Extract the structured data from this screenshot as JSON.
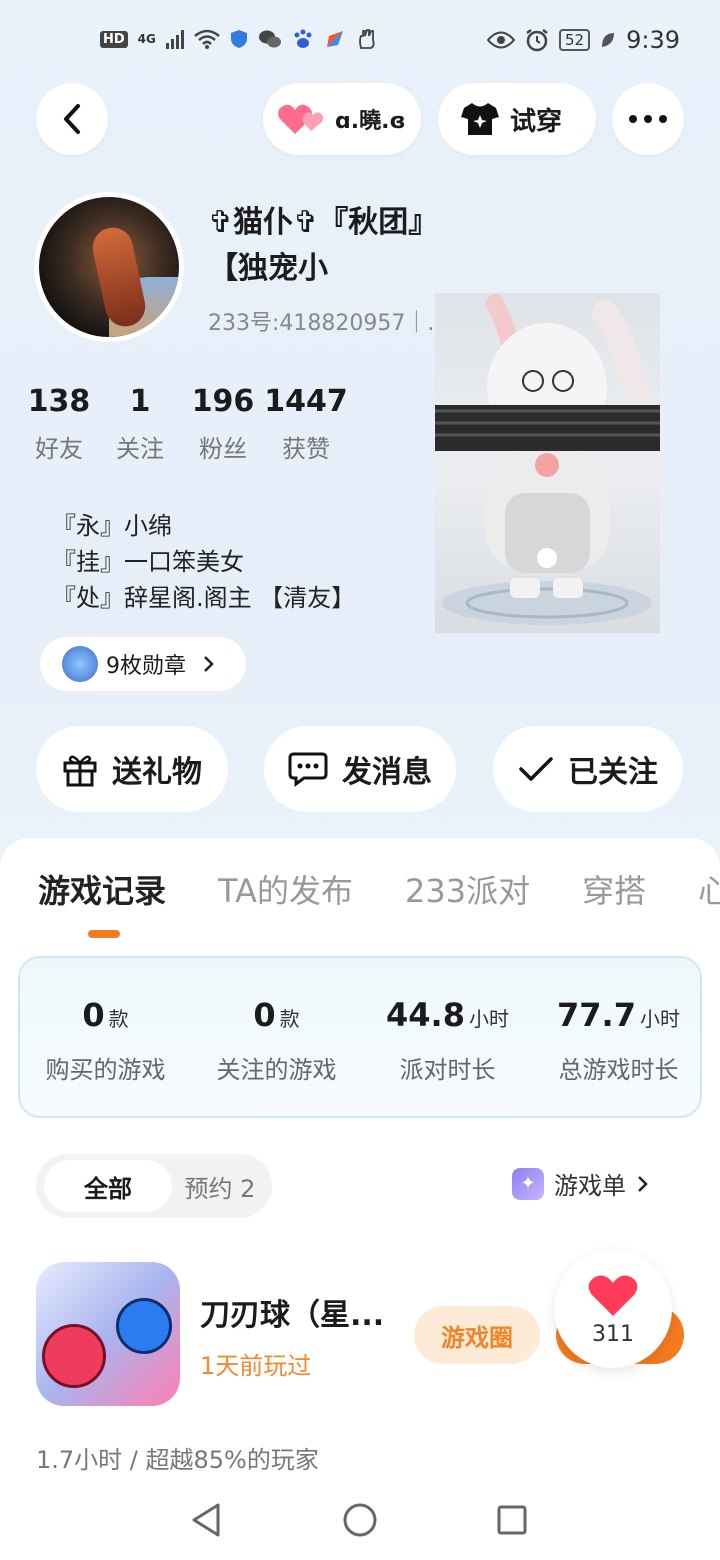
{
  "status_bar": {
    "hd": "HD",
    "network": "4G",
    "time": "9:39",
    "battery": "52"
  },
  "header": {
    "cp_name": "ɑ.曉.ɞ",
    "try_on_label": "试穿"
  },
  "profile": {
    "nickname": "✞猫仆✞『秋团』【独宠小",
    "id_text": "233号:418820957｜..",
    "stats": [
      {
        "num": "138",
        "label": "好友"
      },
      {
        "num": "1",
        "label": "关注"
      },
      {
        "num": "196",
        "label": "粉丝"
      },
      {
        "num": "1447",
        "label": "获赞"
      }
    ],
    "bio": [
      "『永』小绵",
      "『挂』一口笨美女",
      "『处』辞星阁.阁主 【清友】"
    ],
    "badges_label": "9枚勋章"
  },
  "actions": {
    "gift": "送礼物",
    "message": "发消息",
    "followed": "已关注"
  },
  "tabs": [
    "游戏记录",
    "TA的发布",
    "233派对",
    "穿搭",
    "心"
  ],
  "game_stats": [
    {
      "num": "0",
      "unit": "款",
      "label": "购买的游戏"
    },
    {
      "num": "0",
      "unit": "款",
      "label": "关注的游戏"
    },
    {
      "num": "44.8",
      "unit": "小时",
      "label": "派对时长"
    },
    {
      "num": "77.7",
      "unit": "小时",
      "label": "总游戏时长"
    }
  ],
  "segment": {
    "all": "全部",
    "reserve": "预约 2"
  },
  "game_list_label": "游戏单",
  "game": {
    "title": "刀刃球（星...",
    "subtitle": "1天前玩过",
    "circle_btn": "游戏圈",
    "likes": "311",
    "footer": "1.7小时 / 超越85%的玩家"
  },
  "colors": {
    "accent": "#f47a1f",
    "heart": "#ff3b5c",
    "panel_border": "#cfe7f2"
  }
}
